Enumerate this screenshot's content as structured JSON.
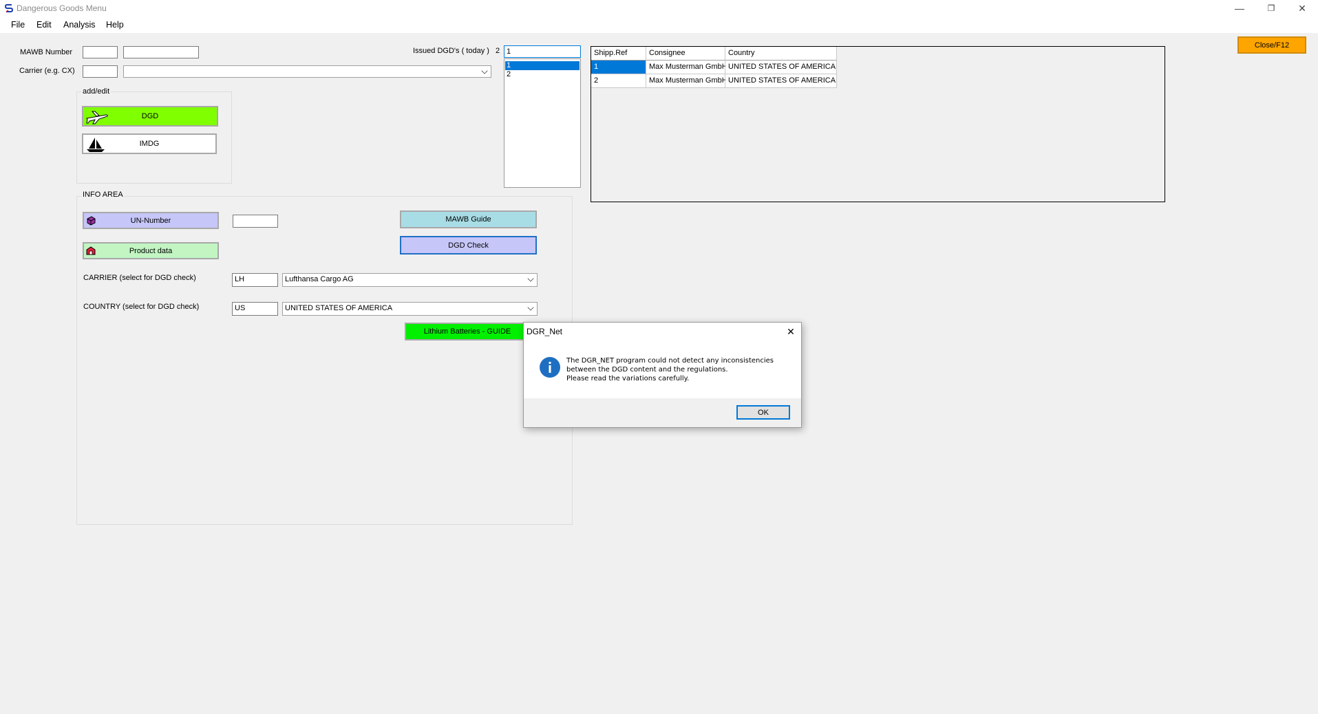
{
  "window": {
    "title": "Dangerous Goods Menu",
    "controls": {
      "minimize": "—",
      "restore": "❐",
      "close": "✕"
    }
  },
  "menu": [
    "File",
    "Edit",
    "Analysis",
    "Help"
  ],
  "mawb": {
    "label": "MAWB Number",
    "prefix_value": "",
    "number_value": ""
  },
  "carrier_top": {
    "label": "Carrier (e.g. CX)",
    "code_value": "",
    "name_value": ""
  },
  "issued": {
    "label": "Issued DGD's ( today )",
    "count": "2",
    "input_value": "1",
    "list": [
      "1",
      "2"
    ]
  },
  "add_edit": {
    "legend": "add/edit",
    "dgd_label": "DGD",
    "imdg_label": "IMDG"
  },
  "info_area": {
    "legend": "INFO AREA",
    "un_number_label": "UN-Number",
    "un_number_value": "",
    "product_data_label": "Product data",
    "mawb_guide_label": "MAWB Guide",
    "dgd_check_label": "DGD Check",
    "carrier_label": "CARRIER (select for DGD check)",
    "carrier_code": "LH",
    "carrier_name": "Lufthansa Cargo AG",
    "country_label": "COUNTRY (select for DGD check)",
    "country_code": "US",
    "country_name": "UNITED STATES OF AMERICA",
    "lithium_label": "Lithium Batteries - GUIDE"
  },
  "close_button": "Close/F12",
  "shipments": {
    "columns": [
      "Shipp.Ref",
      "Consignee",
      "Country"
    ],
    "rows": [
      [
        "1",
        "Max Musterman GmbH",
        "UNITED STATES OF AMERICA"
      ],
      [
        "2",
        "Max Musterman GmbH",
        "UNITED STATES OF AMERICA"
      ]
    ]
  },
  "dialog": {
    "title": "DGR_Net",
    "message_line1": "The DGR_NET program could not detect any inconsistencies",
    "message_line2": "between the DGD content and the regulations.",
    "message_line3": "Please read the variations carefully.",
    "ok_label": "OK",
    "close_glyph": "✕"
  },
  "colors": {
    "dgd_green": "#80ff00",
    "lithium_green": "#00f000",
    "un_purple": "#c6c6f8",
    "product_green": "#c2f5c2",
    "mawb_guide_cyan": "#a8dde6",
    "close_orange": "#ffa500",
    "selection_blue": "#0078d7",
    "info_blue": "#1e6fc2"
  },
  "icons": [
    "app-icon",
    "airplane-icon",
    "ship-icon",
    "book-icon",
    "box-icon",
    "info-icon"
  ]
}
